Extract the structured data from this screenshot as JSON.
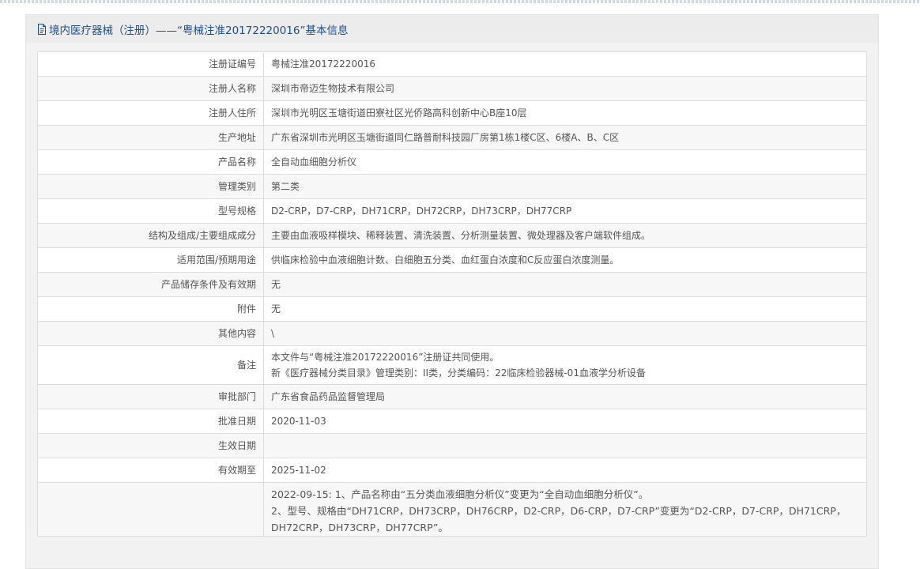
{
  "header": {
    "title": "境内医疗器械（注册）——“粤械注准20172220016”基本信息"
  },
  "rows": [
    {
      "label": "注册证编号",
      "value": "粤械注准20172220016"
    },
    {
      "label": "注册人名称",
      "value": "深圳市帝迈生物技术有限公司"
    },
    {
      "label": "注册人住所",
      "value": "深圳市光明区玉塘街道田寮社区光侨路高科创新中心B座10层"
    },
    {
      "label": "生产地址",
      "value": "广东省深圳市光明区玉塘街道同仁路普耐科技园厂房第1栋1楼C区、6楼A、B、C区"
    },
    {
      "label": "产品名称",
      "value": "全自动血细胞分析仪"
    },
    {
      "label": "管理类别",
      "value": "第二类"
    },
    {
      "label": "型号规格",
      "value": "D2-CRP，D7-CRP，DH71CRP，DH72CRP，DH73CRP，DH77CRP"
    },
    {
      "label": "结构及组成/主要组成成分",
      "value": "主要由血液吸样模块、稀释装置、清洗装置、分析测量装置、微处理器及客户端软件组成。"
    },
    {
      "label": "适用范围/预期用途",
      "value": "供临床检验中血液细胞计数、白细胞五分类、血红蛋白浓度和C反应蛋白浓度测量。"
    },
    {
      "label": "产品储存条件及有效期",
      "value": "无"
    },
    {
      "label": "附件",
      "value": "无"
    },
    {
      "label": "其他内容",
      "value": "\\"
    }
  ],
  "remark": {
    "label": "备注",
    "line1": "本文件与“粤械注准20172220016”注册证共同使用。",
    "line2": "新《医疗器械分类目录》管理类别：II类，分类编码：22临床检验器械-01血液学分析设备"
  },
  "rows2": [
    {
      "label": "审批部门",
      "value": "广东省食品药品监督管理局"
    },
    {
      "label": "批准日期",
      "value": "2020-11-03"
    },
    {
      "label": "生效日期",
      "value": ""
    },
    {
      "label": "有效期至",
      "value": "2025-11-02"
    }
  ],
  "changes": {
    "label": "",
    "line1": "2022-09-15: 1、产品名称由“五分类血液细胞分析仪”变更为“全自动血细胞分析仪”。",
    "line2": "2、型号、规格由“DH71CRP，DH73CRP，DH76CRP，D2-CRP，D6-CRP，D7-CRP”变更为“D2-CRP，D7-CRP，DH71CRP，",
    "line3": "DH72CRP，DH73CRP，DH77CRP”。"
  }
}
